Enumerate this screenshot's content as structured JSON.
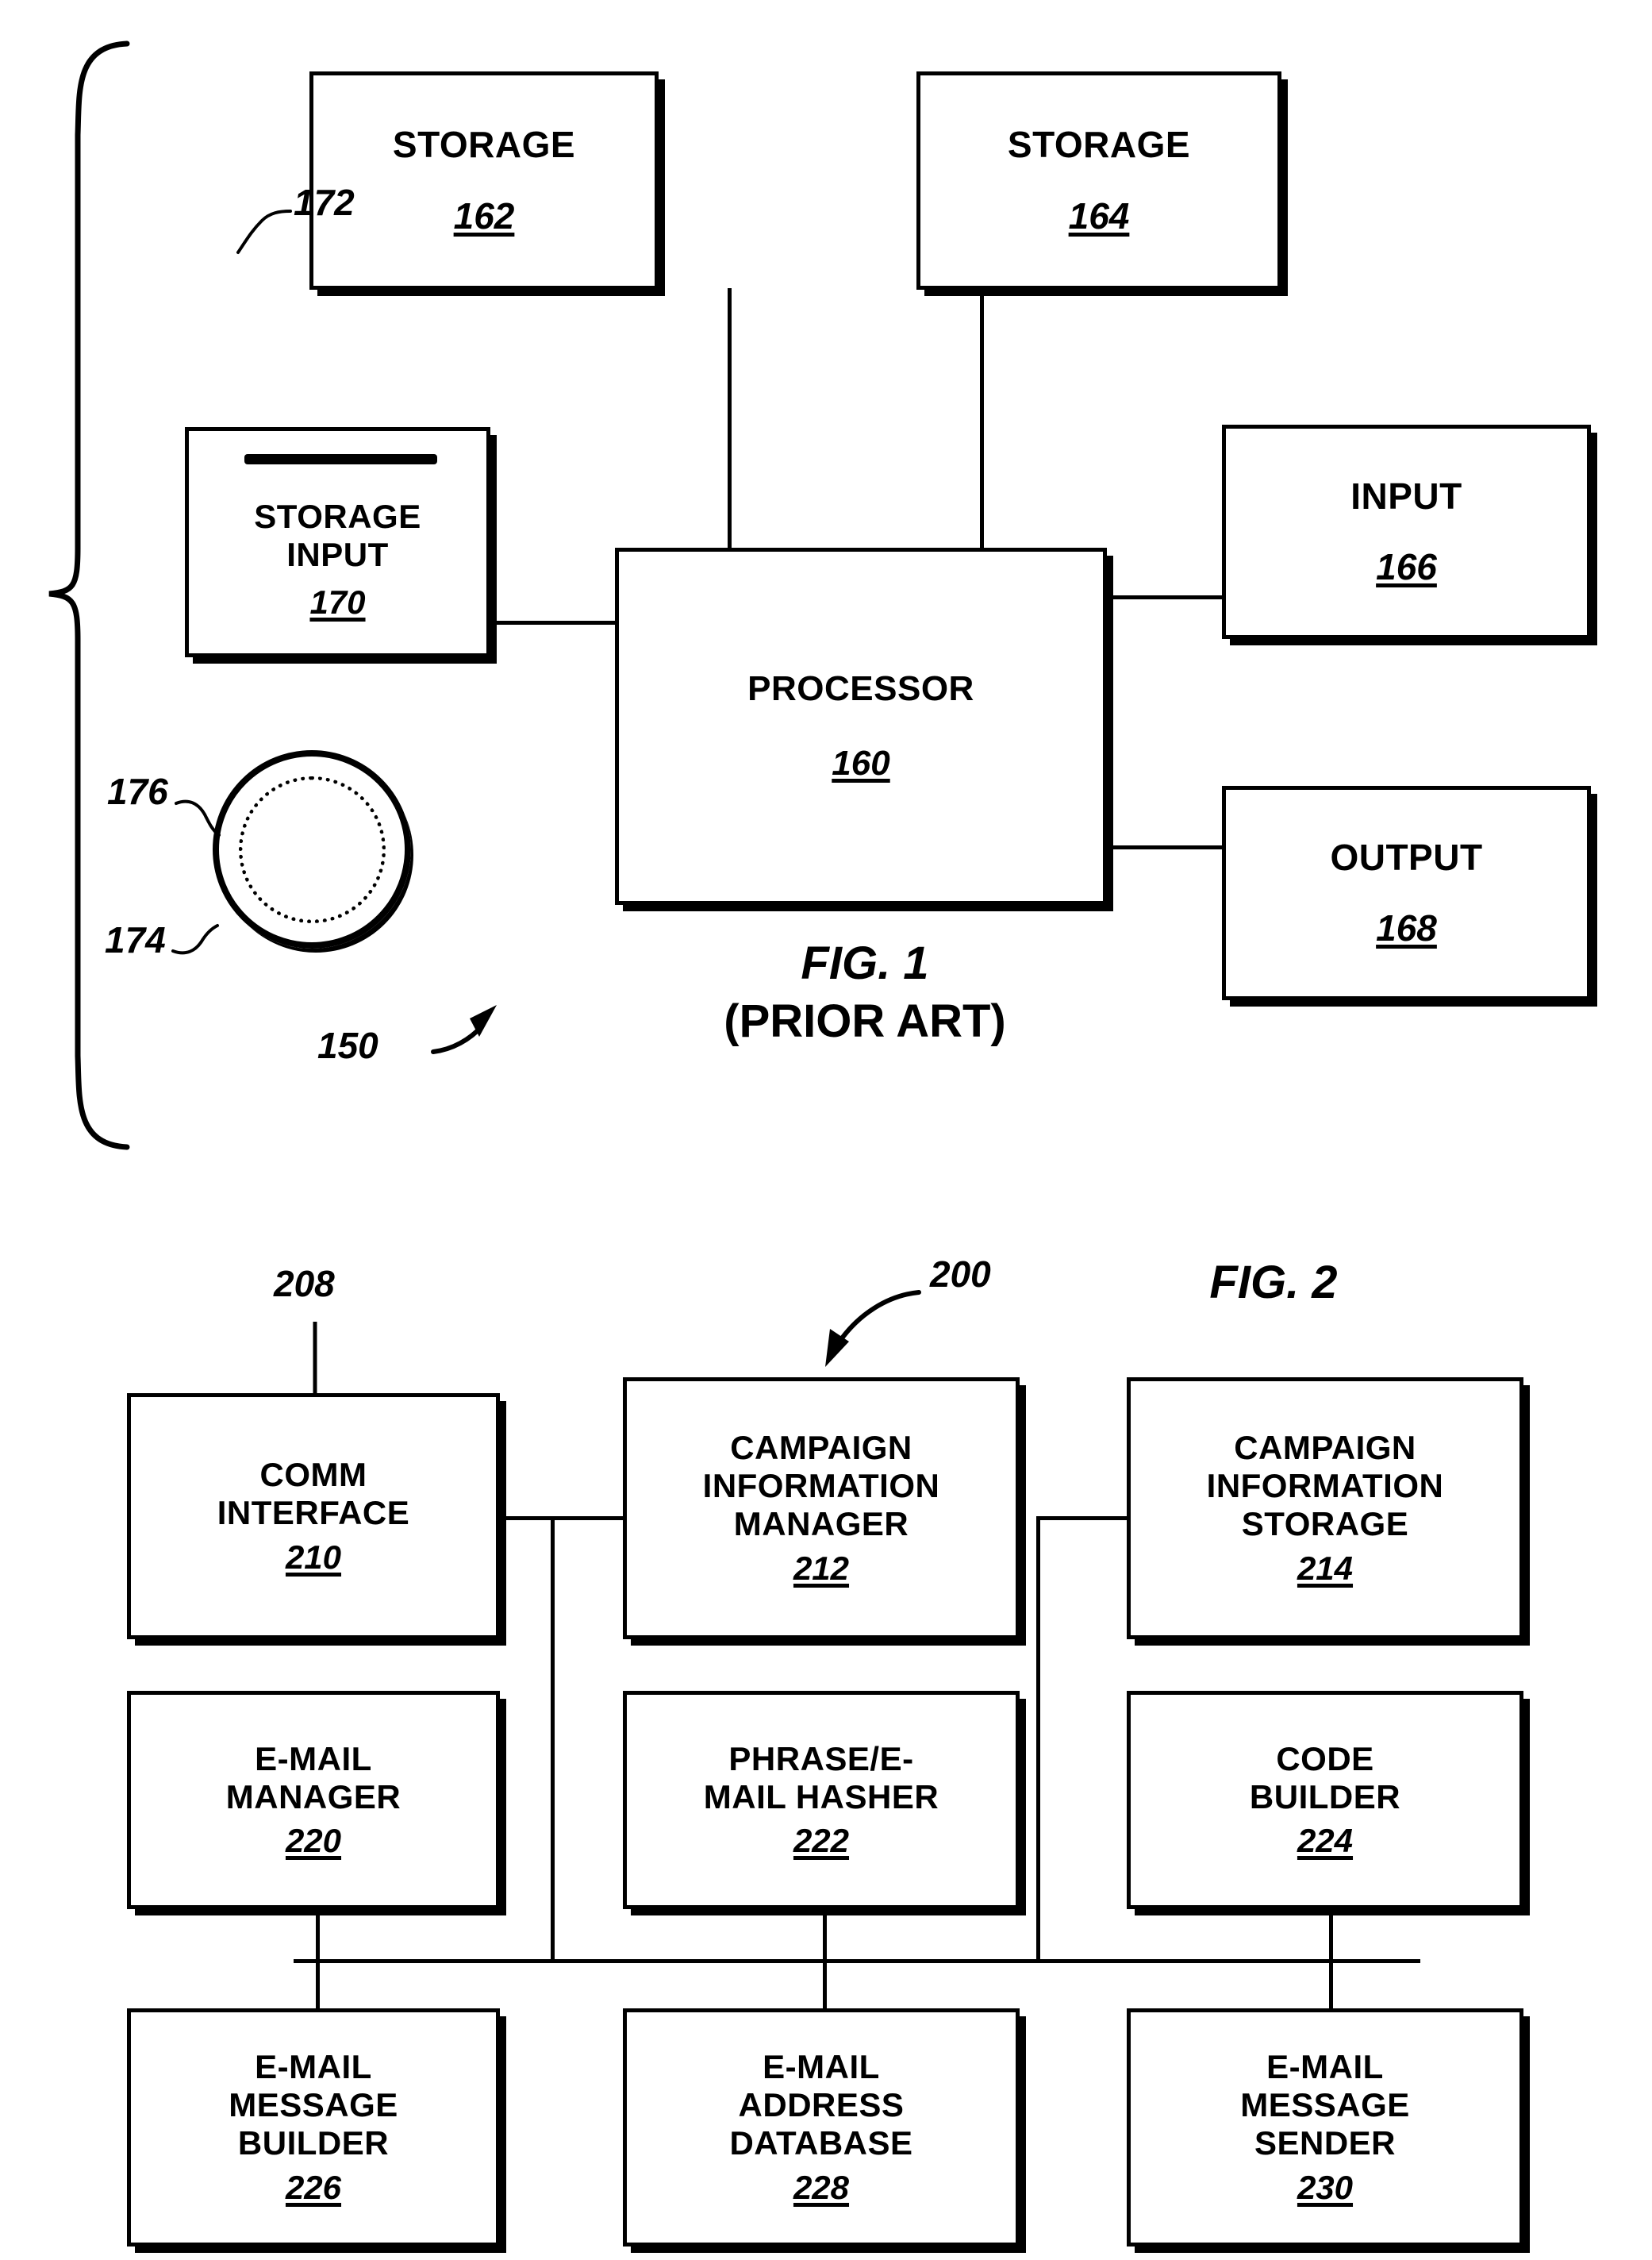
{
  "figure1": {
    "caption_number": "FIG. 1",
    "caption_subtitle": "(PRIOR ART)",
    "system_ref": "150",
    "blocks": {
      "storage_left": {
        "label": "STORAGE",
        "ref": "162"
      },
      "storage_right": {
        "label": "STORAGE",
        "ref": "164"
      },
      "storage_input": {
        "label": "STORAGE\nINPUT",
        "ref": "170"
      },
      "processor": {
        "label": "PROCESSOR",
        "ref": "160"
      },
      "input": {
        "label": "INPUT",
        "ref": "166"
      },
      "output": {
        "label": "OUTPUT",
        "ref": "168"
      }
    },
    "callouts": {
      "slot": "172",
      "disk_media": "174",
      "disk_surface": "176"
    }
  },
  "figure2": {
    "caption_number": "FIG. 2",
    "system_ref": "200",
    "network_ref": "208",
    "blocks": {
      "comm_interface": {
        "label": "COMM\nINTERFACE",
        "ref": "210"
      },
      "campaign_information_manager": {
        "label": "CAMPAIGN\nINFORMATION\nMANAGER",
        "ref": "212"
      },
      "campaign_information_storage": {
        "label": "CAMPAIGN\nINFORMATION\nSTORAGE",
        "ref": "214"
      },
      "email_manager": {
        "label": "E-MAIL\nMANAGER",
        "ref": "220"
      },
      "phrase_email_hasher": {
        "label": "PHRASE/E-\nMAIL HASHER",
        "ref": "222"
      },
      "code_builder": {
        "label": "CODE\nBUILDER",
        "ref": "224"
      },
      "email_message_builder": {
        "label": "E-MAIL\nMESSAGE\nBUILDER",
        "ref": "226"
      },
      "email_address_database": {
        "label": "E-MAIL\nADDRESS\nDATABASE",
        "ref": "228"
      },
      "email_message_sender": {
        "label": "E-MAIL\nMESSAGE\nSENDER",
        "ref": "230"
      }
    }
  },
  "colors": {
    "ink": "#000000",
    "paper": "#ffffff"
  }
}
